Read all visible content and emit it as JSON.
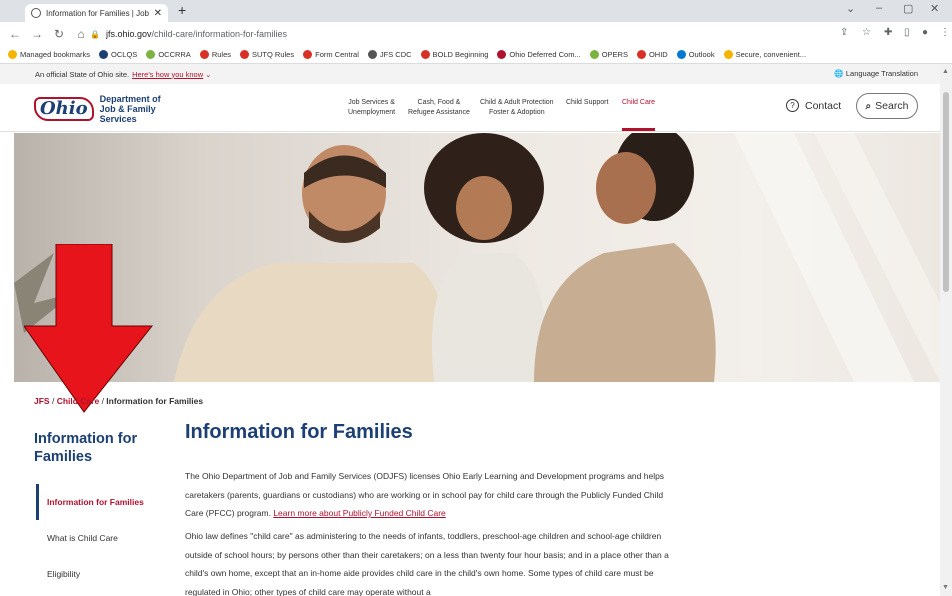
{
  "browser": {
    "tab_title": "Information for Families | Job and",
    "url_host": "jfs.ohio.gov",
    "url_path": "/child-care/information-for-families",
    "bookmarks": [
      {
        "label": "Managed bookmarks",
        "color": "#f4b400"
      },
      {
        "label": "OCLQS",
        "color": "#1c3f74"
      },
      {
        "label": "OCCRRA",
        "color": "#7bb342"
      },
      {
        "label": "Rules",
        "color": "#d93025"
      },
      {
        "label": "SUTQ Rules",
        "color": "#d93025"
      },
      {
        "label": "Form Central",
        "color": "#d93025"
      },
      {
        "label": "JFS CDC",
        "color": "#555555"
      },
      {
        "label": "BOLD Beginning",
        "color": "#d93025"
      },
      {
        "label": "Ohio Deferred Com...",
        "color": "#b0122e"
      },
      {
        "label": "OPERS",
        "color": "#7bb342"
      },
      {
        "label": "OHID",
        "color": "#d93025"
      },
      {
        "label": "Outlook",
        "color": "#0078d4"
      },
      {
        "label": "Secure, convenient...",
        "color": "#f4b400"
      }
    ]
  },
  "gov_banner": {
    "text": "An official State of Ohio site.",
    "link": "Here's how you know",
    "language": "Language Translation"
  },
  "header": {
    "logo_word": "Ohio",
    "dept_line1": "Department of",
    "dept_line2": "Job & Family",
    "dept_line3": "Services",
    "nav": [
      {
        "l1": "Job Services &",
        "l2": "Unemployment"
      },
      {
        "l1": "Cash, Food &",
        "l2": "Refugee Assistance"
      },
      {
        "l1": "Child & Adult Protection",
        "l2": "Foster & Adoption"
      },
      {
        "l1": "Child Support",
        "l2": ""
      },
      {
        "l1": "Child Care",
        "l2": ""
      }
    ],
    "contact": "Contact",
    "search": "Search"
  },
  "breadcrumb": {
    "root": "JFS",
    "section": "Child Care",
    "current": "Information for Families"
  },
  "sidebar": {
    "title": "Information for Families",
    "items": [
      "Information for Families",
      "What is Child Care",
      "Eligibility"
    ]
  },
  "main": {
    "title": "Information for Families",
    "p1": "The Ohio Department of Job and Family Services (ODJFS) licenses Ohio Early Learning and Development programs and helps caretakers (parents, guardians or custodians) who are working or in school pay for child care through the Publicly Funded Child Care (PFCC) program. ",
    "p1_link": "Learn more about Publicly Funded Child Care",
    "p2": "Ohio law defines \"child care\" as administering to the needs of infants, toddlers, preschool-age children and school-age children outside of school hours; by persons other than their caretakers; on a less than twenty four hour basis; and in a place other than a child's own home, except that an in-home aide provides child care in the child's own home.  Some types of child care must be regulated in Ohio; other types of child care may operate without a"
  },
  "colors": {
    "brand_blue": "#1c3f74",
    "brand_red": "#b0122e",
    "annotation_arrow": "#e8141b"
  }
}
